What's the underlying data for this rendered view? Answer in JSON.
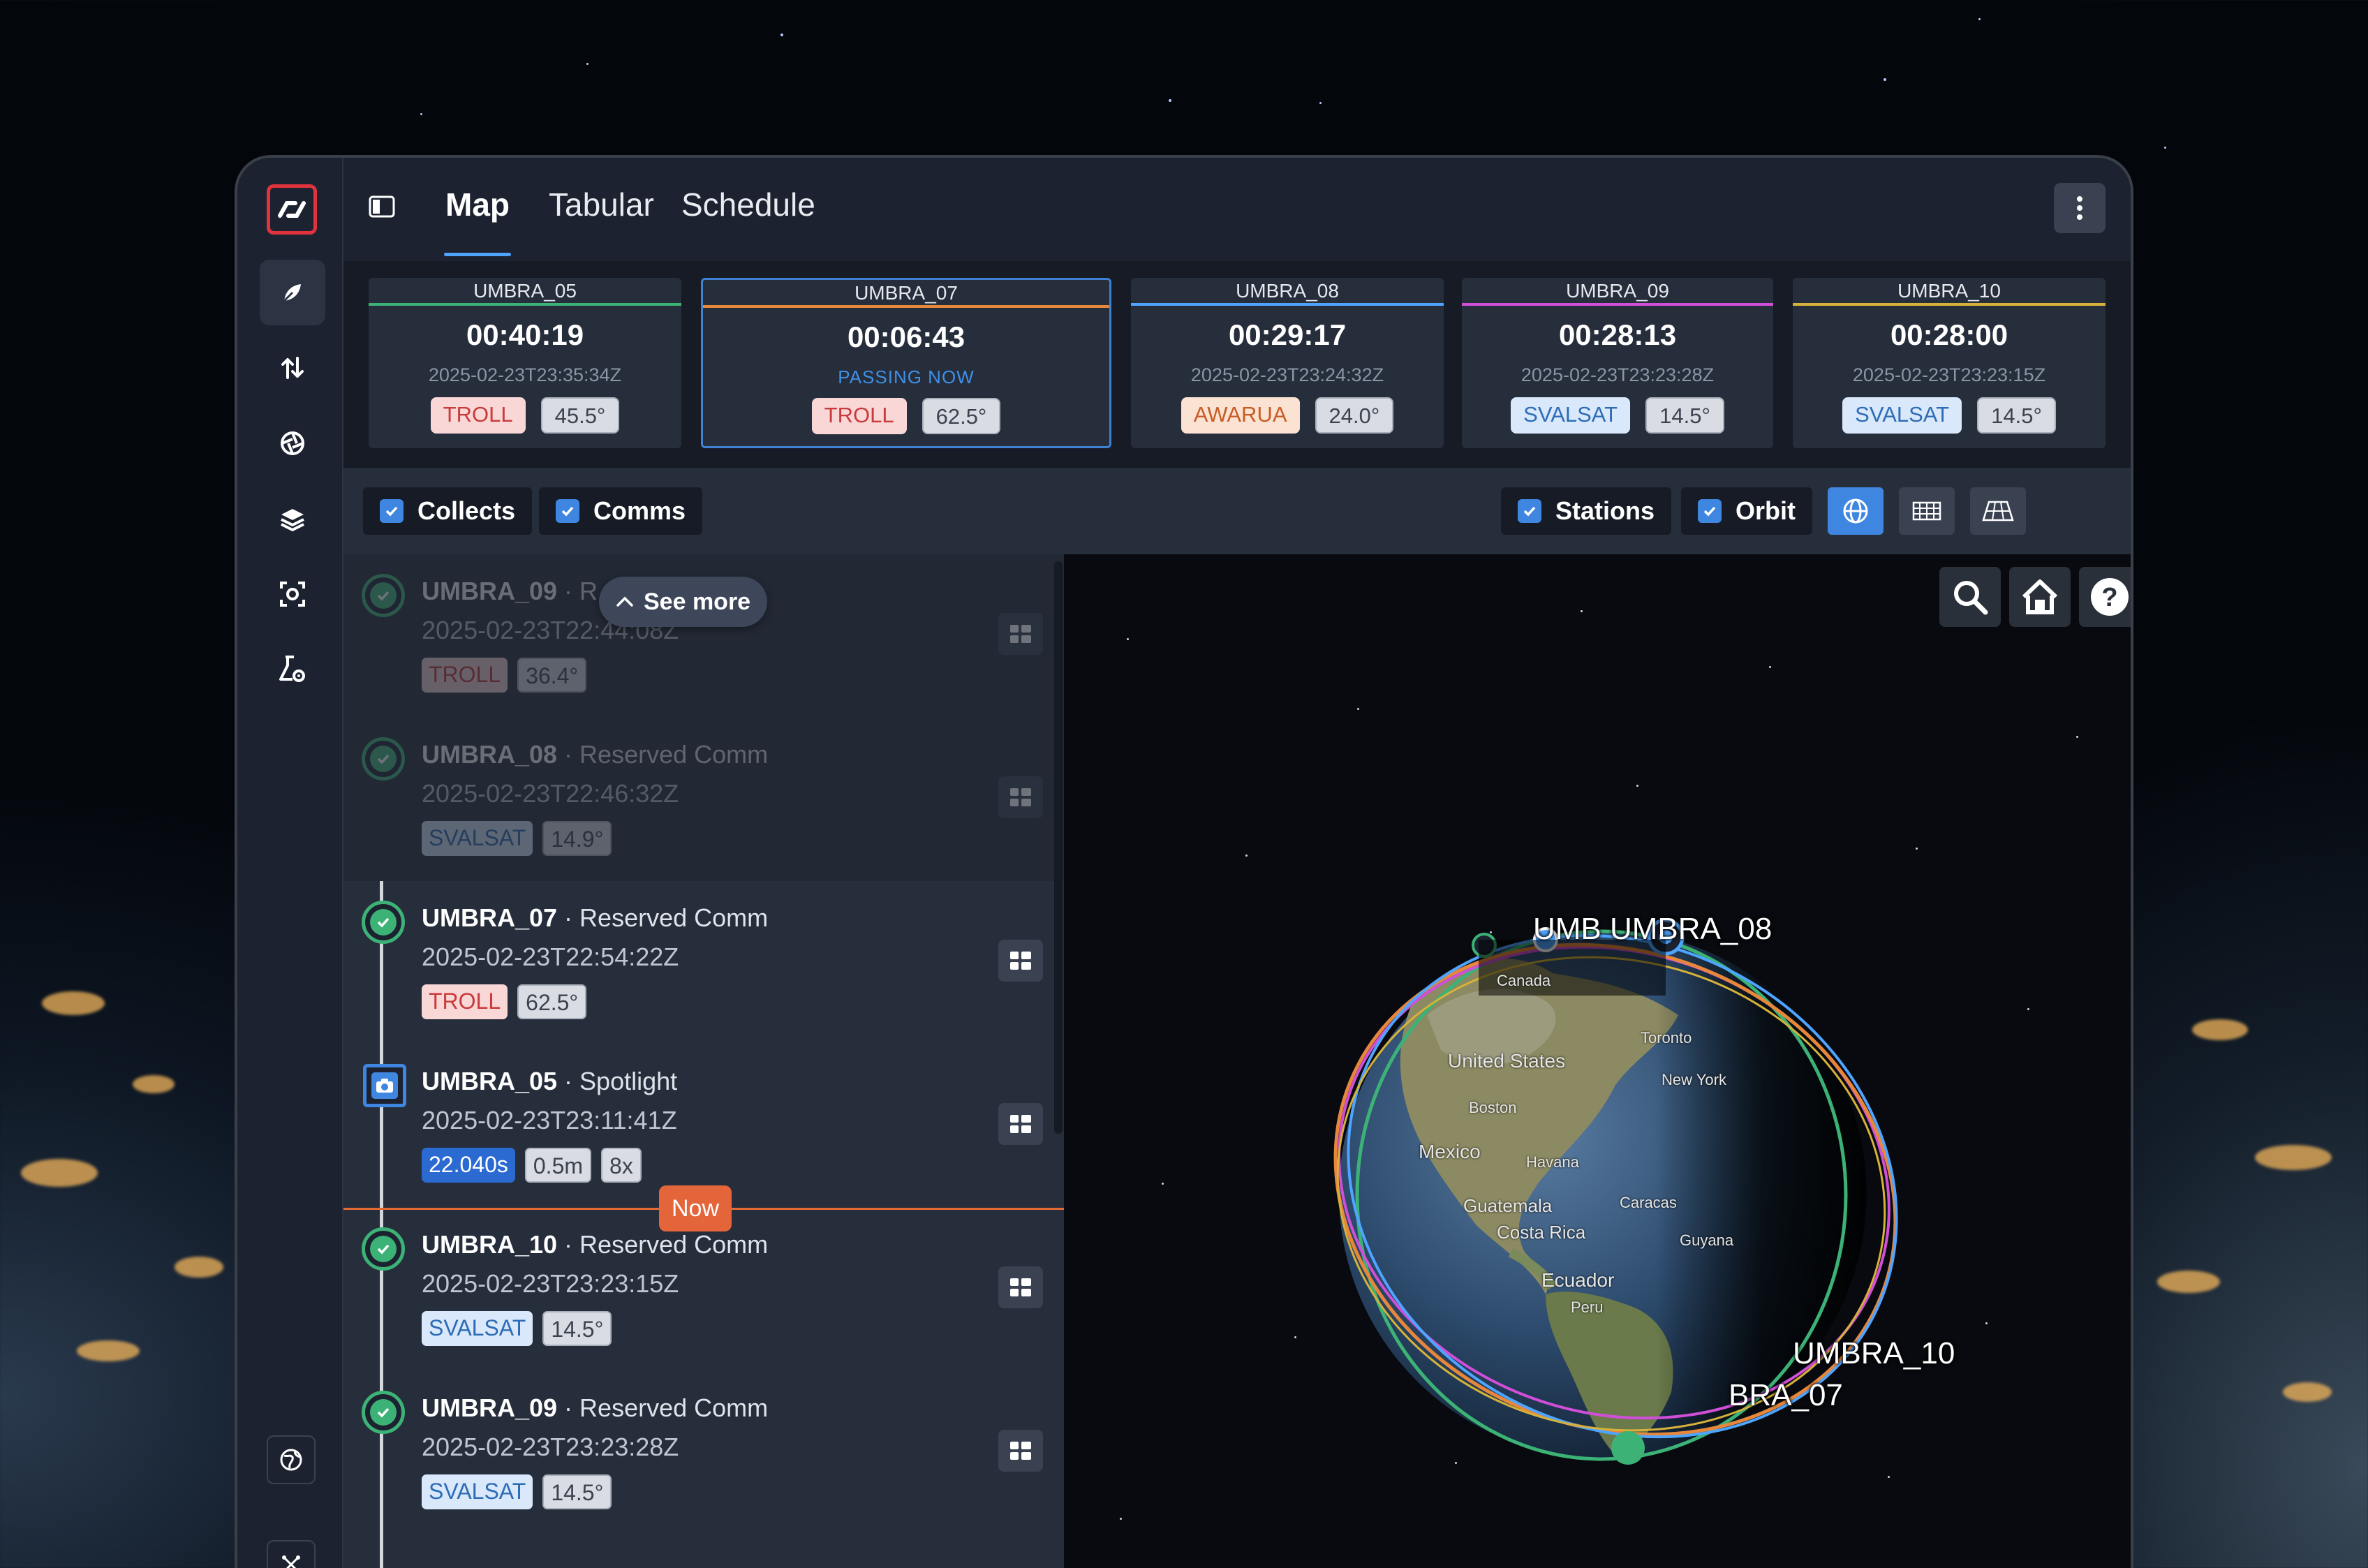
{
  "tabs": [
    {
      "label": "Map",
      "active": true
    },
    {
      "label": "Tabular",
      "active": false
    },
    {
      "label": "Schedule",
      "active": false
    }
  ],
  "rail_icons": [
    "app-logo-icon",
    "satellite-icon",
    "up-down-arrows-icon",
    "aperture-icon",
    "layers-icon",
    "scan-target-icon",
    "flask-gear-icon",
    "globe-icon",
    "connection-icon"
  ],
  "pass_cards": [
    {
      "satellite": "UMBRA_05",
      "countdown": "00:40:19",
      "datetime": "2025-02-23T23:35:34Z",
      "station": "TROLL",
      "elevation": "45.5°",
      "accent": "#3cb276",
      "station_color": "red"
    },
    {
      "satellite": "UMBRA_07",
      "countdown": "00:06:43",
      "status": "PASSING NOW",
      "station": "TROLL",
      "elevation": "62.5°",
      "accent": "#e7873b",
      "station_color": "red",
      "selected": true
    },
    {
      "satellite": "UMBRA_08",
      "countdown": "00:29:17",
      "datetime": "2025-02-23T23:24:32Z",
      "station": "AWARUA",
      "elevation": "24.0°",
      "accent": "#4ea4ff",
      "station_color": "orange"
    },
    {
      "satellite": "UMBRA_09",
      "countdown": "00:28:13",
      "datetime": "2025-02-23T23:23:28Z",
      "station": "SVALSAT",
      "elevation": "14.5°",
      "accent": "#d14fd8",
      "station_color": "blue"
    },
    {
      "satellite": "UMBRA_10",
      "countdown": "00:28:00",
      "datetime": "2025-02-23T23:23:15Z",
      "station": "SVALSAT",
      "elevation": "14.5°",
      "accent": "#d6b23a",
      "station_color": "blue"
    }
  ],
  "filters": {
    "collects": {
      "label": "Collects",
      "checked": true
    },
    "comms": {
      "label": "Comms",
      "checked": true
    },
    "stations": {
      "label": "Stations",
      "checked": true
    },
    "orbit": {
      "label": "Orbit",
      "checked": true
    },
    "view_modes": [
      "globe-view-icon",
      "flat-map-icon",
      "columbus-view-icon"
    ],
    "active_view": "globe-view-icon"
  },
  "see_more_label": "See more",
  "now_label": "Now",
  "timeline": [
    {
      "satellite": "UMBRA_09",
      "type_partial": "R",
      "datetime": "2025-02-23T22:44:08Z",
      "tags": [
        "TROLL",
        "36.4°"
      ],
      "kind": "comm",
      "faded": true
    },
    {
      "satellite": "UMBRA_08",
      "type": "Reserved Comm",
      "datetime": "2025-02-23T22:46:32Z",
      "tags": [
        "SVALSAT",
        "14.9°"
      ],
      "kind": "comm",
      "faded": true
    },
    {
      "satellite": "UMBRA_07",
      "type": "Reserved Comm",
      "datetime": "2025-02-23T22:54:22Z",
      "tags": [
        "TROLL",
        "62.5°"
      ],
      "kind": "comm"
    },
    {
      "satellite": "UMBRA_05",
      "type": "Spotlight",
      "datetime": "2025-02-23T23:11:41Z",
      "tags": [
        "22.040s",
        "0.5m",
        "8x"
      ],
      "kind": "collect"
    },
    {
      "satellite": "UMBRA_10",
      "type": "Reserved Comm",
      "datetime": "2025-02-23T23:23:15Z",
      "tags": [
        "SVALSAT",
        "14.5°"
      ],
      "kind": "comm"
    },
    {
      "satellite": "UMBRA_09",
      "type": "Reserved Comm",
      "datetime": "2025-02-23T23:23:28Z",
      "tags": [
        "SVALSAT",
        "14.5°"
      ],
      "kind": "comm"
    }
  ],
  "map": {
    "controls": [
      "search-icon",
      "home-icon",
      "help-icon"
    ],
    "labels": {
      "top": "UMB UMBRA_08",
      "right_1": "UMBRA_10",
      "right_2": "BRA_07",
      "places": [
        "Canada",
        "United States",
        "Toronto",
        "New York",
        "Boston",
        "Mexico",
        "Havana",
        "Guatemala",
        "Costa Rica",
        "Caracas",
        "Guyana",
        "Ecuador",
        "Peru"
      ]
    }
  }
}
